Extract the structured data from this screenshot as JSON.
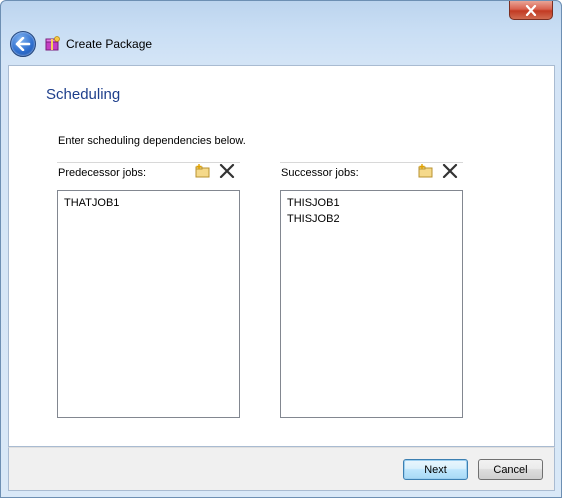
{
  "window": {
    "title": "Create Package"
  },
  "page": {
    "heading": "Scheduling",
    "intro": "Enter scheduling dependencies below."
  },
  "predecessor": {
    "label": "Predecessor jobs:",
    "items": [
      "THATJOB1"
    ]
  },
  "successor": {
    "label": "Successor jobs:",
    "items": [
      "THISJOB1",
      "THISJOB2"
    ]
  },
  "buttons": {
    "next": "Next",
    "cancel": "Cancel"
  },
  "icons": {
    "back": "back-arrow-icon",
    "title": "package-icon",
    "add": "add-folder-icon",
    "remove": "delete-x-icon",
    "close": "close-icon"
  },
  "colors": {
    "heading": "#1e3f8c",
    "close": "#c23a23",
    "back": "#2f6fcf"
  }
}
